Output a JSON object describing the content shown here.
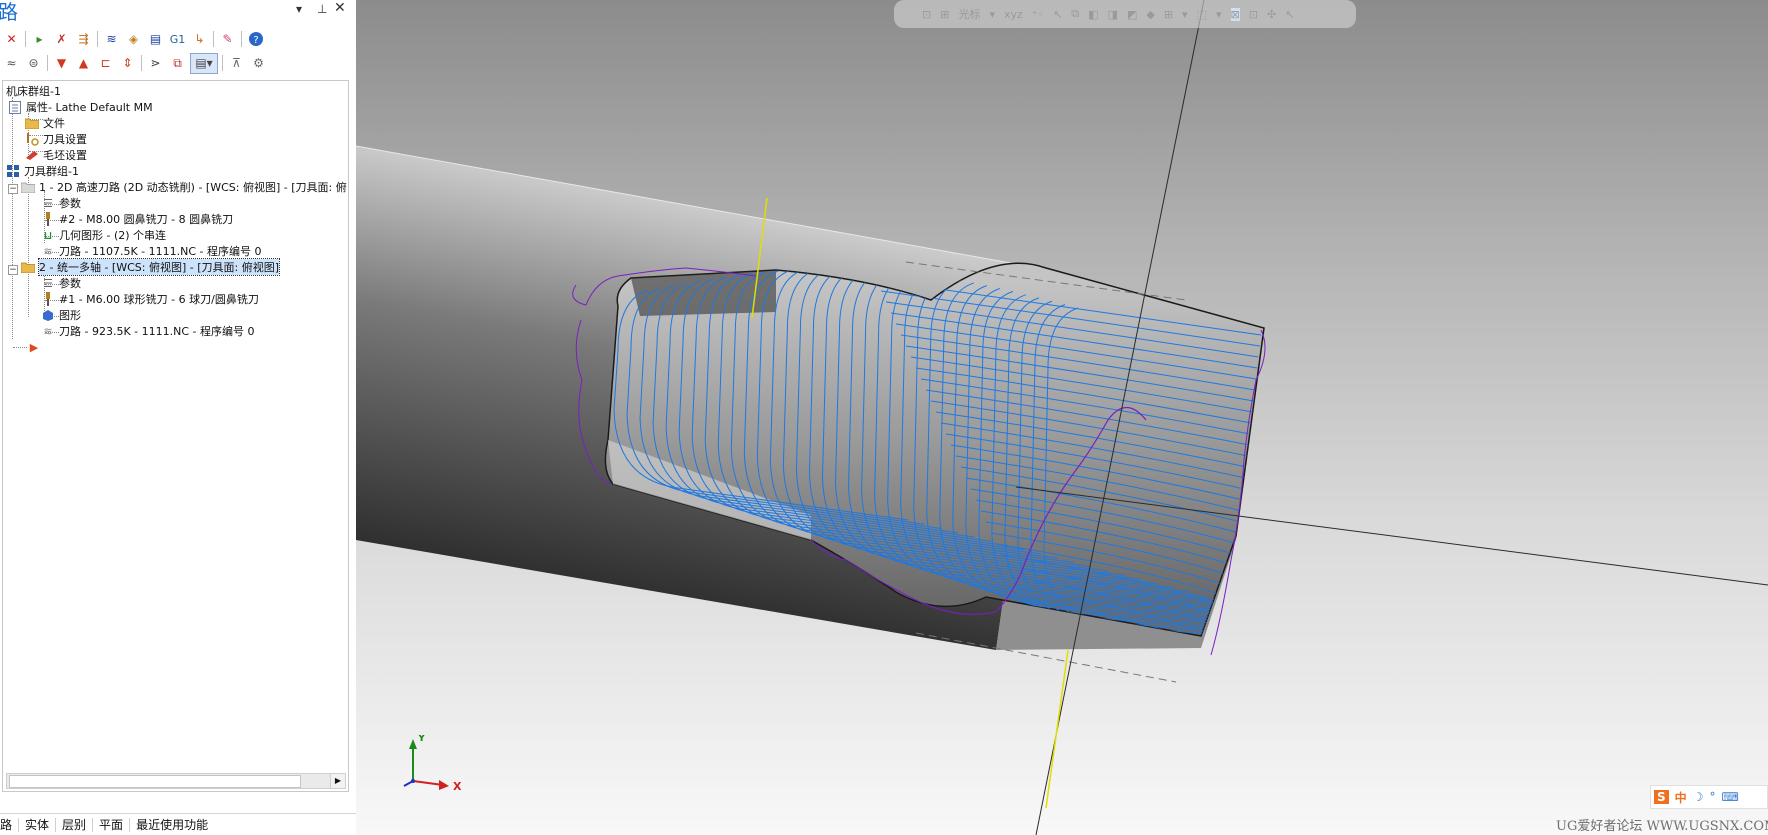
{
  "panel": {
    "title": "路",
    "pin": "▾",
    "pushpin": "⊥",
    "close": "✕"
  },
  "tree": {
    "machine_group": "机床群组-1",
    "properties": "属性",
    "properties_suffix": " - Lathe Default MM",
    "files": "文件",
    "tool_settings": "刀具设置",
    "stock_settings": "毛坯设置",
    "toolpath_group": "刀具群组-1",
    "op1": "1 - 2D 高速刀路 (2D 动态铣削) - [WCS: 俯视图] - [刀具面: 俯",
    "op1_params": "参数",
    "op1_tool": "#2 - M8.00 圆鼻铣刀 - 8 圆鼻铣刀",
    "op1_geometry": "几何图形 - (2) 个串连",
    "op1_path": "刀路 - 1107.5K - 1111.NC - 程序编号 0",
    "op2": "2 - 统一多轴 - [WCS: 俯视图] - [刀具面: 俯视图]",
    "op2_params": "参数",
    "op2_tool": "#1 - M6.00 球形铣刀 - 6 球刀/圆鼻铣刀",
    "op2_geometry": "图形",
    "op2_path": "刀路 - 923.5K - 1111.NC - 程序编号 0"
  },
  "toolbar": {
    "g1_label": "G1"
  },
  "bottom_tabs": [
    "路",
    "实体",
    "层别",
    "平面",
    "最近使用功能"
  ],
  "selection_bar": {
    "cursor_label": "光标",
    "xyz_label": "xyz"
  },
  "triad": {
    "y": "Y",
    "x": "X"
  },
  "ime": {
    "brand": "S",
    "lang": "中",
    "moon": "☽",
    "dot": "°",
    "kbd": "⌨"
  },
  "watermark": "UG爱好者论坛 WWW.UGSNX.COM",
  "colors": {
    "toolpath": "#1f78e0",
    "rapid": "#7a1fc0",
    "axis_line": "#e0e000",
    "title_blue": "#1e6fd0"
  }
}
